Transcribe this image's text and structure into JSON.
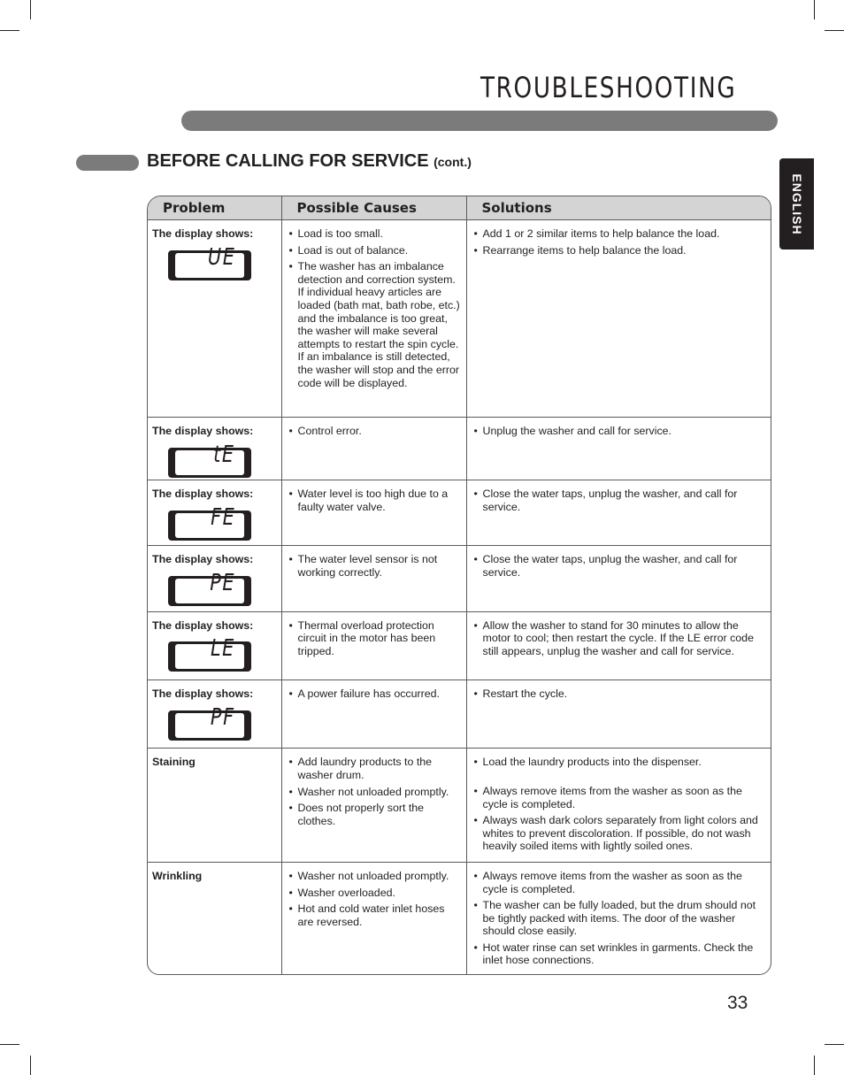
{
  "header": {
    "title": "TROUBLESHOOTING",
    "section_title": "BEFORE CALLING FOR SERVICE",
    "section_suffix": "(cont.)",
    "language_tab": "ENGLISH"
  },
  "table": {
    "columns": [
      "Problem",
      "Possible Causes",
      "Solutions"
    ],
    "rows": [
      {
        "problem": "The display shows:",
        "display_code": "UE",
        "causes": [
          "Load is too small.",
          "Load is out of balance.",
          "The washer has an imbalance detection and correction system. If individual heavy articles are loaded (bath mat, bath robe, etc.) and the imbalance is too great, the washer will make several attempts to restart the spin cycle. If an imbalance is still detected, the washer will stop and the error code will be displayed."
        ],
        "solutions": [
          "Add 1 or 2 similar items to help balance the load.",
          "Rearrange items to help balance the load."
        ]
      },
      {
        "problem": "The display shows:",
        "display_code": "tE",
        "causes": [
          "Control error."
        ],
        "solutions": [
          "Unplug the washer and call for service."
        ]
      },
      {
        "problem": "The display shows:",
        "display_code": "FE",
        "causes": [
          "Water level is too high due to a faulty water valve."
        ],
        "solutions": [
          "Close the water taps, unplug the washer, and call for service."
        ]
      },
      {
        "problem": "The display shows:",
        "display_code": "PE",
        "causes": [
          "The water level sensor is not working correctly."
        ],
        "solutions": [
          "Close the water taps, unplug the washer, and call for service."
        ]
      },
      {
        "problem": "The display shows:",
        "display_code": "LE",
        "causes": [
          "Thermal overload protection circuit in the motor has been tripped."
        ],
        "solutions": [
          "Allow the washer to stand for 30 minutes to allow the motor to cool; then restart the cycle. If the LE error code still appears, unplug the washer and call for service."
        ]
      },
      {
        "problem": "The display shows:",
        "display_code": "PF",
        "causes": [
          "A power failure has occurred."
        ],
        "solutions": [
          "Restart the cycle."
        ]
      },
      {
        "problem": "Staining",
        "causes": [
          "Add laundry products to the washer drum.",
          "Washer not unloaded promptly.",
          "Does not properly sort the clothes."
        ],
        "solutions": [
          "Load the laundry products into the dispenser.",
          "Always remove items from the washer as soon as the cycle is completed.",
          "Always wash dark colors separately from light colors and whites to prevent discoloration. If possible, do not wash heavily soiled items with lightly soiled ones."
        ]
      },
      {
        "problem": "Wrinkling",
        "causes": [
          "Washer not unloaded promptly.",
          "Washer overloaded.",
          "Hot and cold water inlet hoses are reversed."
        ],
        "solutions": [
          "Always remove items from the washer as soon as the cycle is completed.",
          "The washer can be fully loaded, but the drum should not be tightly packed with items. The door of the washer should close easily.",
          "Hot water rinse can set wrinkles in garments. Check the inlet hose connections."
        ]
      }
    ]
  },
  "footer": {
    "page_number": "33"
  },
  "colors": {
    "text": "#231f20",
    "bar_gray": "#7c7b7c",
    "header_gray": "#d4d4d4",
    "tab_black": "#231f20"
  }
}
